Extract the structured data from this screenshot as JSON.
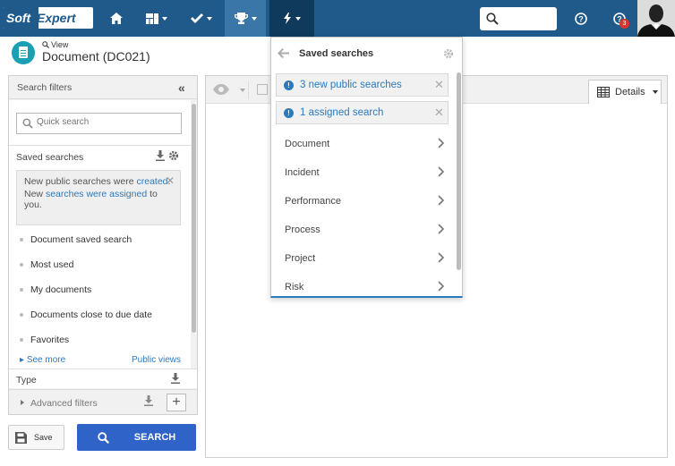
{
  "topbar": {
    "logo_part1": "Soft",
    "logo_part2": "Expert",
    "notification_count": "3"
  },
  "header": {
    "view_label": "View",
    "title": "Document (DC021)"
  },
  "left_panel": {
    "title": "Search filters",
    "quick_search_placeholder": "Quick search",
    "saved_searches_label": "Saved searches",
    "notice": {
      "line1": "New public searches were",
      "line1_link": "created",
      "line1_end": ".",
      "line2_start": "New ",
      "line2_link": "searches were assigned",
      "line2_end": " to you."
    },
    "saved_items": [
      "Document saved search",
      "Most used",
      "My documents",
      "Documents close to due date",
      "Favorites"
    ],
    "see_more": "See more",
    "public_views": "Public views",
    "type_label": "Type",
    "advanced_filters": "Advanced filters"
  },
  "buttons": {
    "save": "Save",
    "search": "SEARCH"
  },
  "right_panel": {
    "details_label": "Details"
  },
  "dropdown": {
    "title": "Saved searches",
    "alerts": [
      "3 new public searches",
      "1 assigned search"
    ],
    "items": [
      "Document",
      "Incident",
      "Performance",
      "Process",
      "Project",
      "Risk"
    ]
  },
  "colors": {
    "topbar": "#1f5a8a",
    "active_nav": "#0f3a5c",
    "link_blue": "#2a7abf",
    "search_button": "#2f63c8",
    "badge": "#d9342b"
  }
}
